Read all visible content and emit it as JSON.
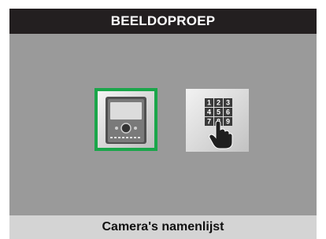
{
  "header": {
    "title": "BEELDOPROEP"
  },
  "options": [
    {
      "icon": "intercom-monitor-icon",
      "selected": true
    },
    {
      "icon": "keypad-dial-icon",
      "selected": false
    }
  ],
  "footer": {
    "label": "Camera's namenlijst"
  },
  "keypad_digits": [
    "1",
    "2",
    "3",
    "4",
    "5",
    "6",
    "7",
    "8",
    "9"
  ],
  "colors": {
    "title_bg": "#231f20",
    "screen_bg": "#9a9a9a",
    "selection": "#1aa64a",
    "footer_bg": "#d4d4d4"
  }
}
